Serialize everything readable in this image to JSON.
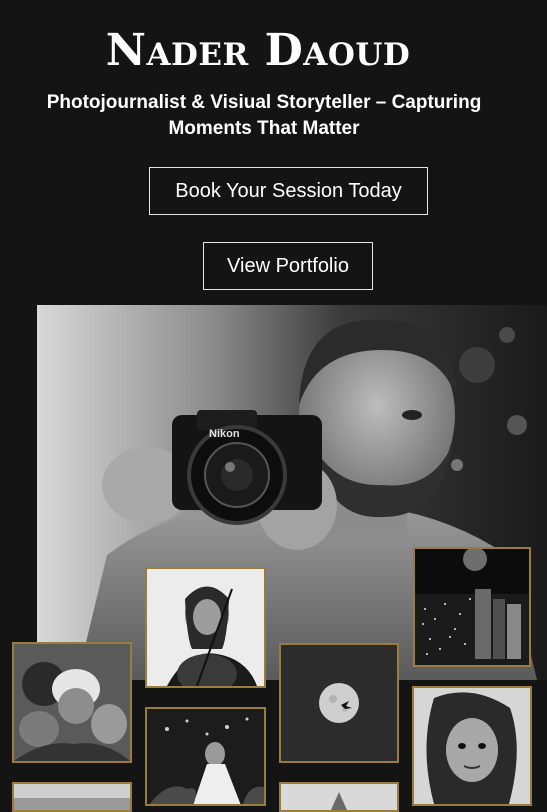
{
  "header": {
    "title": "Nader Daoud",
    "subtitle": "Photojournalist & Visiual Storyteller – Capturing Moments That Matter"
  },
  "buttons": {
    "book": "Book Your Session Today",
    "portfolio": "View Portfolio"
  },
  "hero": {
    "camera_brand": "Nikon"
  },
  "colors": {
    "background": "#141414",
    "tile_border": "#9a7c3e",
    "button_border": "#e6e6e6"
  }
}
